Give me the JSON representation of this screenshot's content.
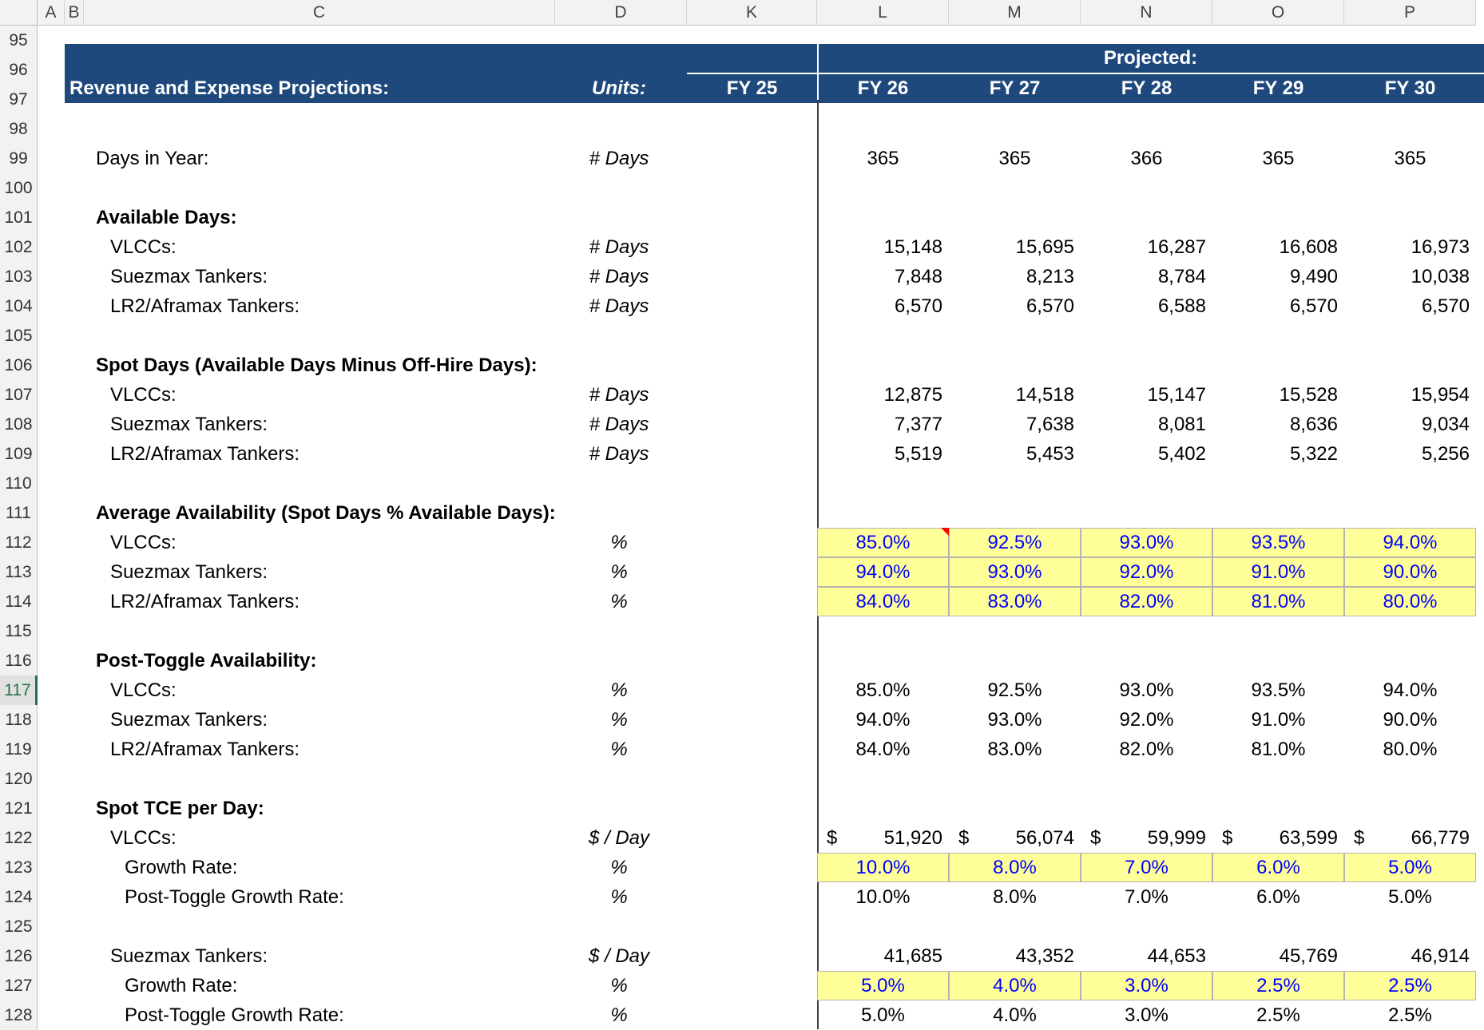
{
  "columns": [
    "A",
    "B",
    "C",
    "D",
    "K",
    "L",
    "M",
    "N",
    "O",
    "P"
  ],
  "rows": [
    "95",
    "96",
    "97",
    "98",
    "99",
    "100",
    "101",
    "102",
    "103",
    "104",
    "105",
    "106",
    "107",
    "108",
    "109",
    "110",
    "111",
    "112",
    "113",
    "114",
    "115",
    "116",
    "117",
    "118",
    "119",
    "120",
    "121",
    "122",
    "123",
    "124",
    "125",
    "126",
    "127",
    "128"
  ],
  "active_row": "117",
  "header": {
    "title": "Revenue and Expense Projections:",
    "units": "Units:",
    "projected": "Projected:",
    "years": [
      "FY 25",
      "FY 26",
      "FY 27",
      "FY 28",
      "FY 29",
      "FY 30"
    ]
  },
  "sections": {
    "days_in_year": {
      "label": "Days in Year:",
      "unit": "# Days",
      "values": [
        "365",
        "365",
        "366",
        "365",
        "365"
      ]
    },
    "available_days": {
      "title": "Available Days:",
      "rows": [
        {
          "label": "VLCCs:",
          "unit": "# Days",
          "values": [
            "15,148",
            "15,695",
            "16,287",
            "16,608",
            "16,973"
          ]
        },
        {
          "label": "Suezmax Tankers:",
          "unit": "# Days",
          "values": [
            "7,848",
            "8,213",
            "8,784",
            "9,490",
            "10,038"
          ]
        },
        {
          "label": "LR2/Aframax Tankers:",
          "unit": "# Days",
          "values": [
            "6,570",
            "6,570",
            "6,588",
            "6,570",
            "6,570"
          ]
        }
      ]
    },
    "spot_days": {
      "title": "Spot Days (Available Days Minus Off-Hire Days):",
      "rows": [
        {
          "label": "VLCCs:",
          "unit": "# Days",
          "values": [
            "12,875",
            "14,518",
            "15,147",
            "15,528",
            "15,954"
          ]
        },
        {
          "label": "Suezmax Tankers:",
          "unit": "# Days",
          "values": [
            "7,377",
            "7,638",
            "8,081",
            "8,636",
            "9,034"
          ]
        },
        {
          "label": "LR2/Aframax Tankers:",
          "unit": "# Days",
          "values": [
            "5,519",
            "5,453",
            "5,402",
            "5,322",
            "5,256"
          ]
        }
      ]
    },
    "avg_availability": {
      "title": "Average Availability (Spot Days % Available Days):",
      "rows": [
        {
          "label": "VLCCs:",
          "unit": "%",
          "values": [
            "85.0%",
            "92.5%",
            "93.0%",
            "93.5%",
            "94.0%"
          ]
        },
        {
          "label": "Suezmax Tankers:",
          "unit": "%",
          "values": [
            "94.0%",
            "93.0%",
            "92.0%",
            "91.0%",
            "90.0%"
          ]
        },
        {
          "label": "LR2/Aframax Tankers:",
          "unit": "%",
          "values": [
            "84.0%",
            "83.0%",
            "82.0%",
            "81.0%",
            "80.0%"
          ]
        }
      ]
    },
    "post_toggle": {
      "title": "Post-Toggle Availability:",
      "rows": [
        {
          "label": "VLCCs:",
          "unit": "%",
          "values": [
            "85.0%",
            "92.5%",
            "93.0%",
            "93.5%",
            "94.0%"
          ]
        },
        {
          "label": "Suezmax Tankers:",
          "unit": "%",
          "values": [
            "94.0%",
            "93.0%",
            "92.0%",
            "91.0%",
            "90.0%"
          ]
        },
        {
          "label": "LR2/Aframax Tankers:",
          "unit": "%",
          "values": [
            "84.0%",
            "83.0%",
            "82.0%",
            "81.0%",
            "80.0%"
          ]
        }
      ]
    },
    "spot_tce": {
      "title": "Spot TCE per Day:",
      "vlcc": {
        "label": "VLCCs:",
        "unit": "$ / Day",
        "currency": "$",
        "values": [
          "51,920",
          "56,074",
          "59,999",
          "63,599",
          "66,779"
        ]
      },
      "vlcc_growth": {
        "label": "Growth Rate:",
        "unit": "%",
        "values": [
          "10.0%",
          "8.0%",
          "7.0%",
          "6.0%",
          "5.0%"
        ]
      },
      "vlcc_post": {
        "label": "Post-Toggle Growth Rate:",
        "unit": "%",
        "values": [
          "10.0%",
          "8.0%",
          "7.0%",
          "6.0%",
          "5.0%"
        ]
      },
      "suez": {
        "label": "Suezmax Tankers:",
        "unit": "$ / Day",
        "values": [
          "41,685",
          "43,352",
          "44,653",
          "45,769",
          "46,914"
        ]
      },
      "suez_growth": {
        "label": "Growth Rate:",
        "unit": "%",
        "values": [
          "5.0%",
          "4.0%",
          "3.0%",
          "2.5%",
          "2.5%"
        ]
      },
      "suez_post": {
        "label": "Post-Toggle Growth Rate:",
        "unit": "%",
        "values": [
          "5.0%",
          "4.0%",
          "3.0%",
          "2.5%",
          "2.5%"
        ]
      }
    }
  },
  "colors": {
    "banner": "#1f497d",
    "input_fill": "#ffff99",
    "input_font": "#0000ff",
    "active_row": "#217346"
  }
}
